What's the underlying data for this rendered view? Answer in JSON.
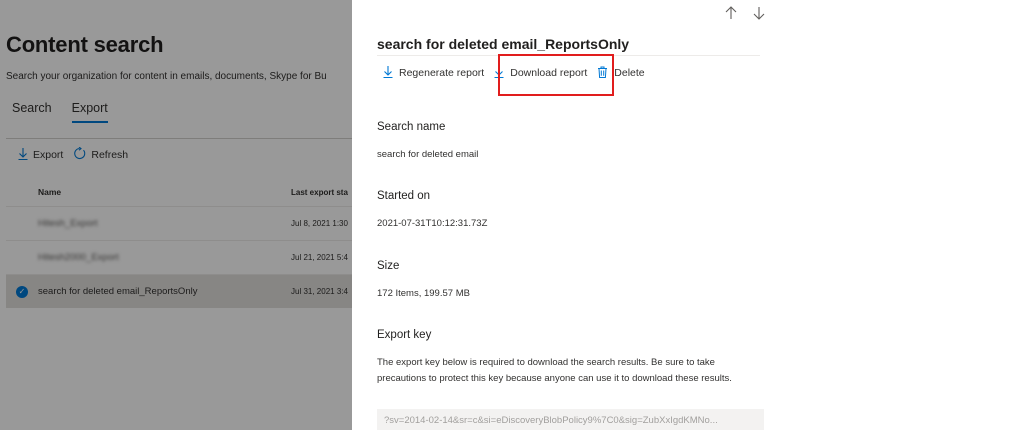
{
  "background": {
    "title": "Content search",
    "subtitle": "Search your organization for content in emails, documents, Skype for Bu",
    "tabs": [
      {
        "label": "Search"
      },
      {
        "label": "Export"
      }
    ],
    "toolbar": {
      "export_label": "Export",
      "refresh_label": "Refresh"
    },
    "table": {
      "headers": {
        "name": "Name",
        "last_export": "Last export sta"
      },
      "rows": [
        {
          "name": "Hitesh_Export",
          "date": "Jul 8, 2021 1:30"
        },
        {
          "name": "Hitesh2000_Export",
          "date": "Jul 21, 2021 5:4"
        },
        {
          "name": "search for deleted email_ReportsOnly",
          "date": "Jul 31, 2021 3:4"
        }
      ]
    }
  },
  "panel": {
    "nav": {
      "up": "↑",
      "down": "↓"
    },
    "title": "search for deleted email_ReportsOnly",
    "commands": {
      "regenerate": "Regenerate report",
      "download": "Download report",
      "delete": "Delete"
    },
    "fields": {
      "search_name_label": "Search name",
      "search_name_value": "search for deleted email",
      "started_on_label": "Started on",
      "started_on_value": "2021-07-31T10:12:31.73Z",
      "size_label": "Size",
      "size_value": "172 Items, 199.57 MB",
      "export_key_label": "Export key"
    },
    "export_key_note": "The export key below is required to download the search results. Be sure to take precautions to protect this key because anyone can use it to download these results.",
    "export_key_value": "?sv=2014-02-14&sr=c&si=eDiscoveryBlobPolicy9%7C0&sig=ZubXxIgdKMNo..."
  },
  "colors": {
    "accent": "#0078d4",
    "highlight": "#e11d1d",
    "overlay": "rgba(0,0,0,0.40)"
  },
  "icons": {
    "download": "download-arrow-icon",
    "refresh": "refresh-icon",
    "delete": "trash-icon",
    "selected": "checkmark-circle-icon"
  }
}
